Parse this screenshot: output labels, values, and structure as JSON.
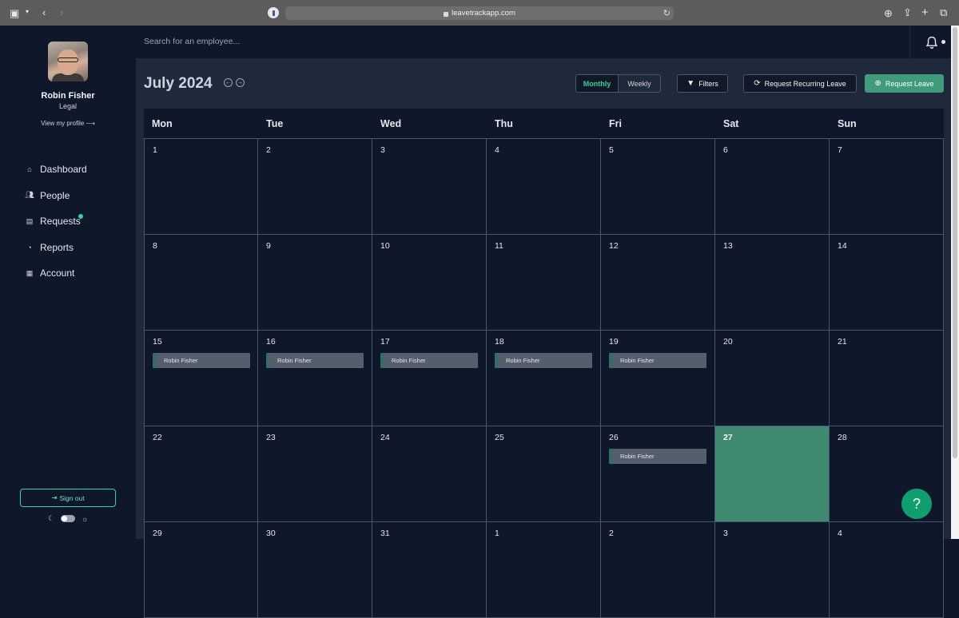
{
  "browser": {
    "url": "leavetrackapp.com"
  },
  "user": {
    "name": "Robin Fisher",
    "department": "Legal",
    "profile_link": "View my profile ⟶"
  },
  "nav": [
    {
      "label": "Dashboard",
      "icon": "home-icon"
    },
    {
      "label": "People",
      "icon": "people-icon"
    },
    {
      "label": "Requests",
      "icon": "clipboard-icon",
      "has_notification": true
    },
    {
      "label": "Reports",
      "icon": "chart-icon"
    },
    {
      "label": "Account",
      "icon": "building-icon"
    }
  ],
  "signout_label": "Sign out",
  "search": {
    "placeholder": "Search for an employee..."
  },
  "calendar": {
    "title": "July 2024",
    "views": {
      "monthly": "Monthly",
      "weekly": "Weekly"
    },
    "filters_label": "Filters",
    "recurring_label": "Request Recurring Leave",
    "request_label": "Request Leave",
    "weekdays": [
      "Mon",
      "Tue",
      "Wed",
      "Thu",
      "Fri",
      "Sat",
      "Sun"
    ],
    "days": [
      "1",
      "2",
      "3",
      "4",
      "5",
      "6",
      "7",
      "8",
      "9",
      "10",
      "11",
      "12",
      "13",
      "14",
      "15",
      "16",
      "17",
      "18",
      "19",
      "20",
      "21",
      "22",
      "23",
      "24",
      "25",
      "26",
      "27",
      "28",
      "29",
      "30",
      "31",
      "1",
      "2",
      "3",
      "4"
    ],
    "today_index": 26,
    "events": [
      {
        "day_index": 14,
        "label": "Robin Fisher"
      },
      {
        "day_index": 15,
        "label": "Robin Fisher"
      },
      {
        "day_index": 16,
        "label": "Robin Fisher"
      },
      {
        "day_index": 17,
        "label": "Robin Fisher"
      },
      {
        "day_index": 18,
        "label": "Robin Fisher"
      },
      {
        "day_index": 25,
        "label": "Robin Fisher"
      }
    ]
  },
  "help_label": "?",
  "colors": {
    "accent": "#34d399",
    "today": "#3f8b6f",
    "primary_button": "#3f9b7a"
  }
}
